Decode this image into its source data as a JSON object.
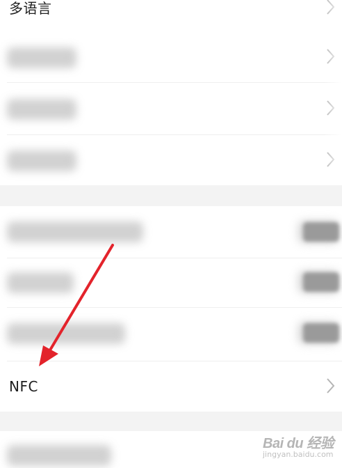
{
  "settings": {
    "multilanguage_label": "多语言",
    "nfc_label": "NFC"
  },
  "watermark": {
    "brand": "Bai du 经验",
    "sub": "jingyan.baidu.com"
  },
  "colors": {
    "arrow": "#e3232b",
    "chevron": "#b5b5b5",
    "group_gap": "#f3f3f3"
  },
  "icons": {
    "chevron": "chevron-right-icon",
    "arrow": "red-annotation-arrow"
  }
}
